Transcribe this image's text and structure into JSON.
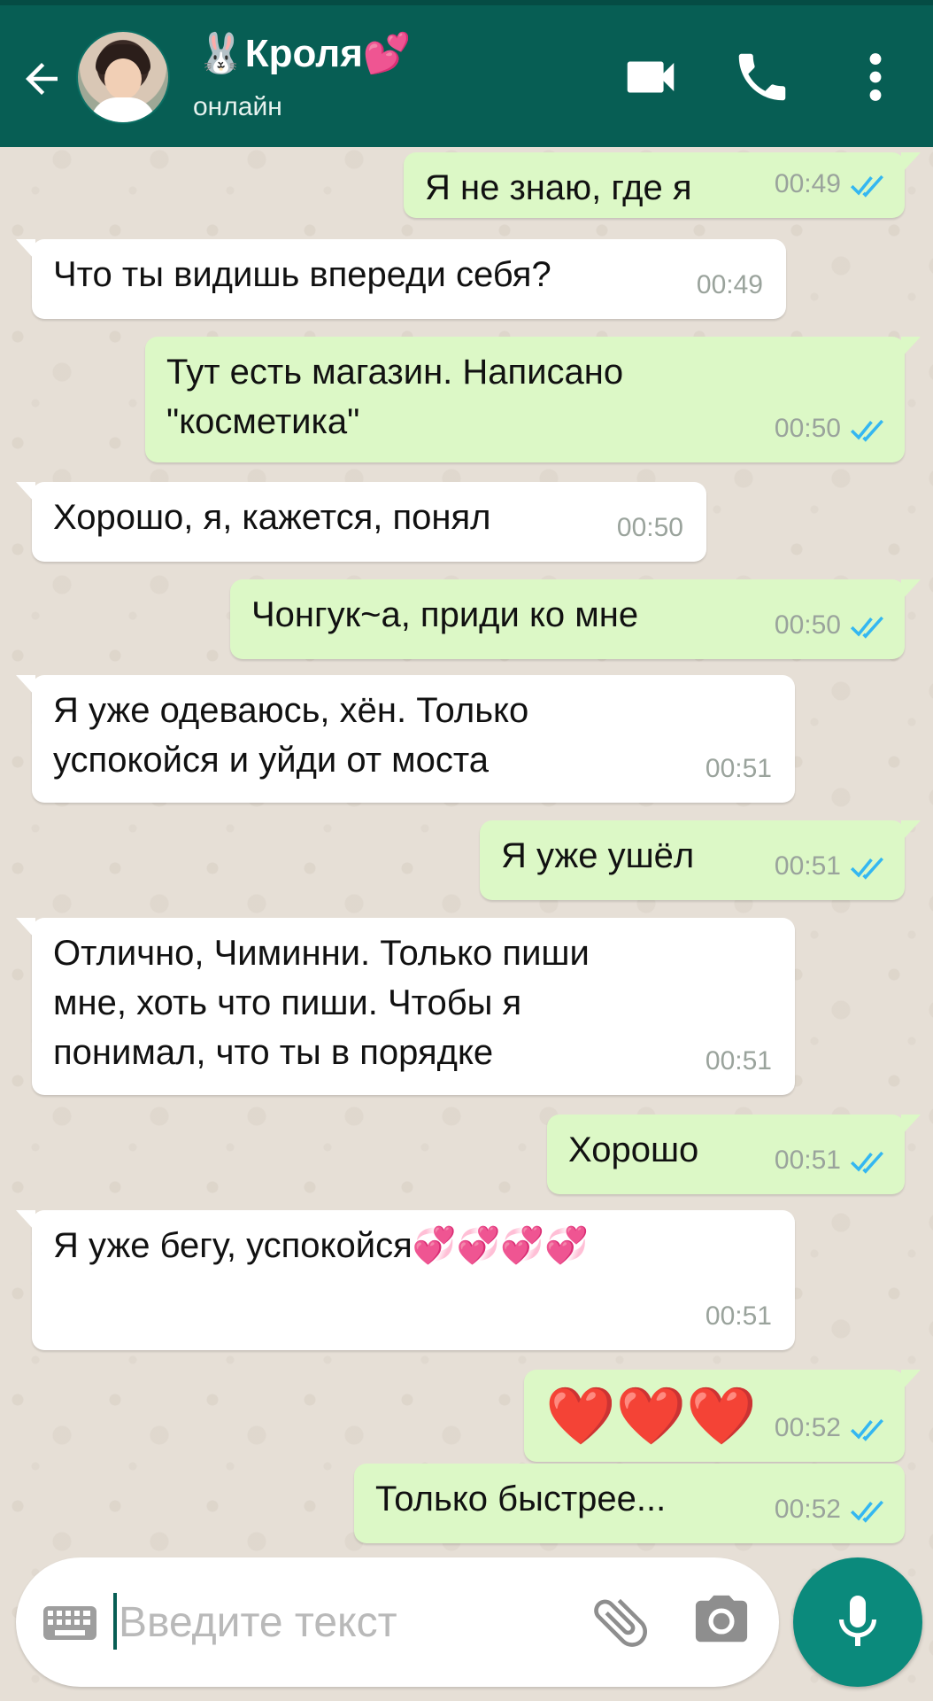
{
  "header": {
    "contact_name": "🐰Кроля💕",
    "status": "онлайн",
    "colors": {
      "bar": "#075e54",
      "bubble_out": "#dcf8c6",
      "bubble_in": "#ffffff",
      "tick": "#34b7f1"
    }
  },
  "messages": [
    {
      "dir": "out",
      "text": "Я не знаю, где я",
      "time": "00:49",
      "read": true
    },
    {
      "dir": "in",
      "text": "Что ты видишь впереди себя?",
      "time": "00:49"
    },
    {
      "dir": "out",
      "text": "Тут есть магазин. Написано\n\"косметика\"",
      "time": "00:50",
      "read": true
    },
    {
      "dir": "in",
      "text": "Хорошо, я, кажется, понял",
      "time": "00:50"
    },
    {
      "dir": "out",
      "text": "Чонгук~а, приди ко мне",
      "time": "00:50",
      "read": true
    },
    {
      "dir": "in",
      "text": "Я уже одеваюсь, хён. Только\nуспокойся и уйди от моста",
      "time": "00:51"
    },
    {
      "dir": "out",
      "text": "Я уже ушёл",
      "time": "00:51",
      "read": true
    },
    {
      "dir": "in",
      "text": "Отлично, Чиминни. Только пиши\nмне, хоть что пиши. Чтобы я\nпонимал, что ты в порядке",
      "time": "00:51"
    },
    {
      "dir": "out",
      "text": "Хорошо",
      "time": "00:51",
      "read": true
    },
    {
      "dir": "in",
      "text": "Я уже бегу, успокойся💞💞💞💞",
      "time": "00:51"
    },
    {
      "dir": "out",
      "text": "❤️❤️❤️",
      "time": "00:52",
      "read": true
    },
    {
      "dir": "out",
      "text": "Только быстрее...",
      "time": "00:52",
      "read": true
    }
  ],
  "composer": {
    "placeholder": "Введите текст"
  },
  "icons": {
    "back": "arrow-left-icon",
    "video": "video-camera-icon",
    "call": "phone-icon",
    "menu": "more-vert-icon",
    "keyboard": "keyboard-icon",
    "attach": "paperclip-icon",
    "camera": "camera-icon",
    "mic": "microphone-icon"
  }
}
